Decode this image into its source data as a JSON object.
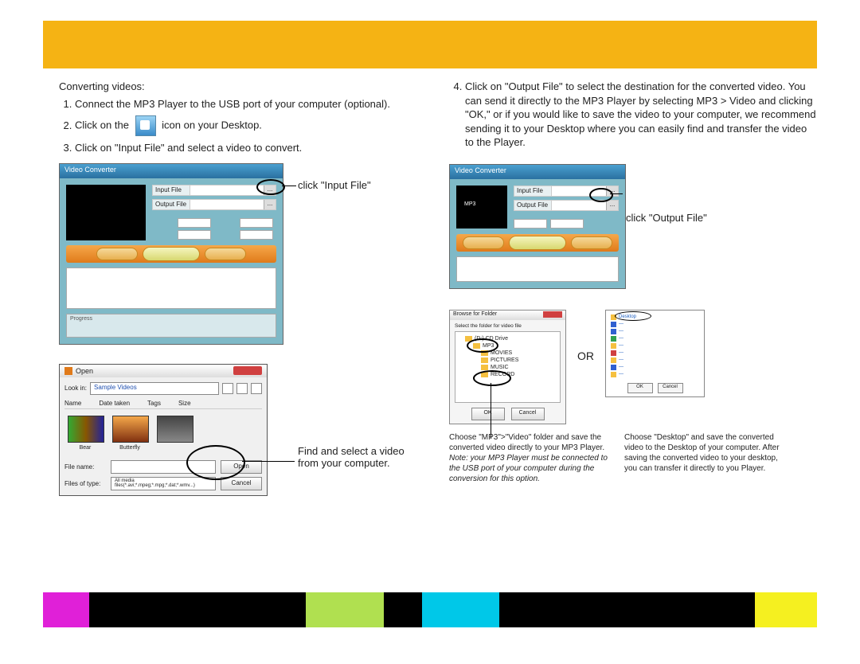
{
  "header": {},
  "left": {
    "heading": "Converting videos:",
    "step1": "Connect the MP3 Player to the USB port of your computer (optional).",
    "step2_a": "Click on the",
    "step2_b": "icon on your Desktop.",
    "step3": "Click on \"Input File\" and select a video to convert.",
    "callout_input": "click \"Input File\"",
    "callout_select": "Find and select a video from your computer."
  },
  "right": {
    "step4": "Click on \"Output File\" to select the destination for the converted video. You can send it directly to the MP3 Player by selecting MP3 > Video and clicking \"OK,\" or if you would like to save the video to your computer, we recommend sending it to your Desktop where you can easily find and transfer the video to the Player.",
    "callout_output": "click \"Output File\"",
    "or_label": "OR",
    "caption_left_1": "Choose \"MP3\">\"Video\" folder and save the converted video directly to your MP3 Player.",
    "caption_left_2": "Note: your MP3 Player must be connected to the USB port of your computer during the conversion for this option.",
    "caption_right": "Choose \"Desktop\" and save the converted video to the Desktop of your computer. After saving the converted video to your desktop, you can transfer it directly to you Player."
  },
  "vc": {
    "title": "Video Converter",
    "input_label": "Input File",
    "output_label": "Output File",
    "progress_label": "Progress",
    "mp3_lbl": "MP3"
  },
  "open": {
    "title": "Open",
    "look_in": "Look in:",
    "folder": "Sample Videos",
    "col_name": "Name",
    "col_date": "Date taken",
    "col_tags": "Tags",
    "col_size": "Size",
    "thumb1": "Bear",
    "thumb2": "Butterfly",
    "thumb3": "",
    "file_name_lbl": "File name:",
    "file_type_lbl": "Files of type:",
    "file_type_val": "All media files(*.avi;*.mpeg;*.mpg;*.dat;*.wmv...)",
    "btn_open": "Open",
    "btn_cancel": "Cancel"
  },
  "browse": {
    "title": "Browse for Folder",
    "prompt": "Select the folder for video file",
    "row_cd": "(D:) CD Drive",
    "row_mp3": "MP3",
    "row_mov": "MOVIES",
    "row_pic": "PICTURES",
    "row_mus": "MUSIC",
    "row_rec": "RECORD",
    "btn_ok": "OK",
    "btn_cancel": "Cancel"
  },
  "desk": {
    "row_desktop": "Desktop",
    "btn_ok": "OK",
    "btn_cancel": "Cancel"
  }
}
